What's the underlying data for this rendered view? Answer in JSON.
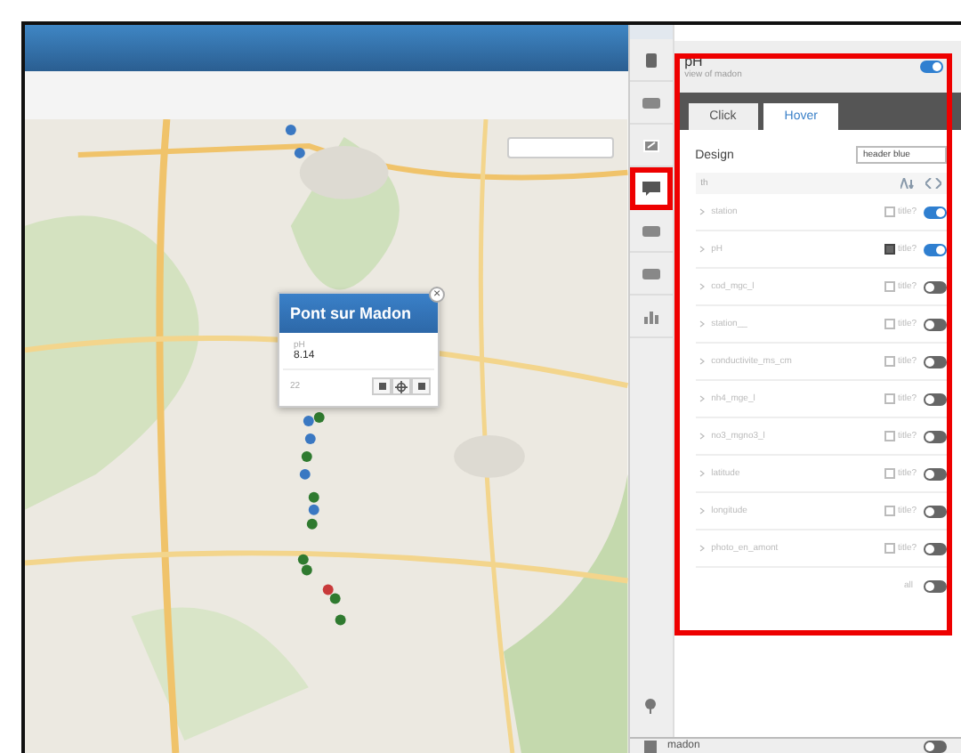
{
  "map": {
    "popup": {
      "title": "Pont sur Madon",
      "field_label": "pH",
      "field_value": "8.14",
      "count": "22",
      "close": "×"
    }
  },
  "sidebar": {
    "items": [
      {
        "selected": false
      },
      {
        "selected": false
      },
      {
        "selected": false
      },
      {
        "selected": true
      },
      {
        "selected": false
      },
      {
        "selected": false
      },
      {
        "selected": false
      }
    ]
  },
  "panel": {
    "title": "pH",
    "subtitle": "view of madon",
    "enabled": true,
    "tabs": [
      {
        "label": "Click",
        "selected": false
      },
      {
        "label": "Hover",
        "selected": true
      }
    ],
    "design_label": "Design",
    "design_value": "header blue",
    "filter": "th",
    "fields": [
      {
        "name": "station",
        "title_checked": false,
        "title_label": "title?",
        "on": true
      },
      {
        "name": "pH",
        "title_checked": true,
        "title_label": "title?",
        "on": true
      },
      {
        "name": "cod_mgc_l",
        "title_checked": false,
        "title_label": "title?",
        "on": false
      },
      {
        "name": "station__",
        "title_checked": false,
        "title_label": "title?",
        "on": false
      },
      {
        "name": "conductivite_ms_cm",
        "title_checked": false,
        "title_label": "title?",
        "on": false
      },
      {
        "name": "nh4_mge_l",
        "title_checked": false,
        "title_label": "title?",
        "on": false
      },
      {
        "name": "no3_mgno3_l",
        "title_checked": false,
        "title_label": "title?",
        "on": false
      },
      {
        "name": "latitude",
        "title_checked": false,
        "title_label": "title?",
        "on": false
      },
      {
        "name": "longitude",
        "title_checked": false,
        "title_label": "title?",
        "on": false
      },
      {
        "name": "photo_en_amont",
        "title_checked": false,
        "title_label": "title?",
        "on": false
      }
    ],
    "all_label": "all",
    "all_on": false
  },
  "footer": {
    "layer": "madon",
    "on": false
  }
}
